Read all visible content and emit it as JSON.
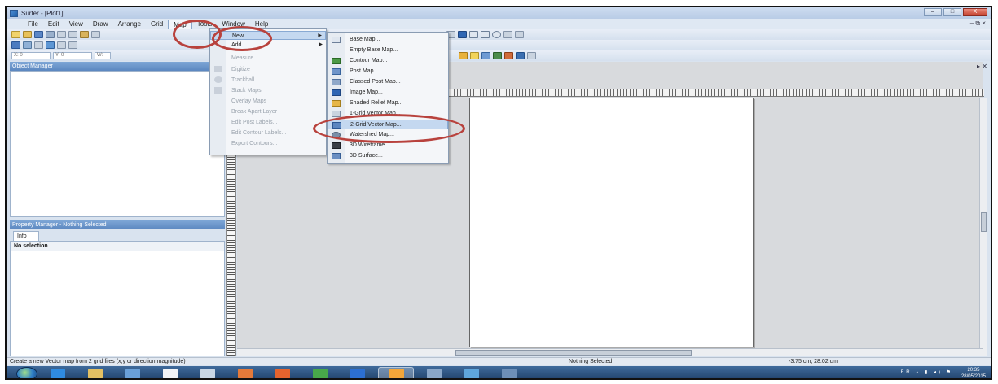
{
  "window": {
    "title": "Surfer - [Plot1]",
    "min": "–",
    "max": "□",
    "close": "X",
    "mdi_controls": "– ⧉ ×"
  },
  "menubar": [
    "File",
    "Edit",
    "View",
    "Draw",
    "Arrange",
    "Grid",
    "Map",
    "Tools",
    "Window",
    "Help"
  ],
  "toolbar": {
    "select1": "X: 0",
    "select2": "Y: 0",
    "select3": "W:"
  },
  "panels": {
    "object_manager": "Object Manager",
    "property_manager": "Property Manager - Nothing Selected",
    "info_tab": "Info",
    "no_selection": "No selection"
  },
  "map_menu": [
    {
      "label": "New",
      "state": "highlighted",
      "submenu": true
    },
    {
      "label": "Add",
      "state": "normal",
      "submenu": true
    },
    {
      "label": "Measure",
      "state": "disabled"
    },
    {
      "label": "Digitize",
      "state": "disabled"
    },
    {
      "label": "Trackball",
      "state": "disabled"
    },
    {
      "label": "Stack Maps",
      "state": "disabled"
    },
    {
      "label": "Overlay Maps",
      "state": "disabled"
    },
    {
      "label": "Break Apart Layer",
      "state": "disabled"
    },
    {
      "label": "Edit Post Labels...",
      "state": "disabled"
    },
    {
      "label": "Edit Contour Labels...",
      "state": "disabled"
    },
    {
      "label": "Export Contours...",
      "state": "disabled"
    }
  ],
  "new_submenu": [
    "Base Map...",
    "Empty Base Map...",
    "Contour Map...",
    "Post Map...",
    "Classed Post Map...",
    "Image Map...",
    "Shaded Relief Map...",
    "1-Grid Vector Map...",
    "2-Grid Vector Map...",
    "Watershed Map...",
    "3D Wireframe...",
    "3D Surface..."
  ],
  "status": {
    "hint": "Create a new Vector map from 2 grid files (x,y or direction,magnitude)",
    "selection": "Nothing Selected",
    "coords": "-3.75 cm, 28.02 cm"
  },
  "taskbar": {
    "tray": "FR ▴ ▮ ◂) ⚑",
    "time": "20:35",
    "date": "28/05/2015"
  },
  "colors": {
    "highlight_ring": "#b8423d",
    "menu_highlight": "#c4d8f0",
    "titlebar": "#b9cce6"
  }
}
